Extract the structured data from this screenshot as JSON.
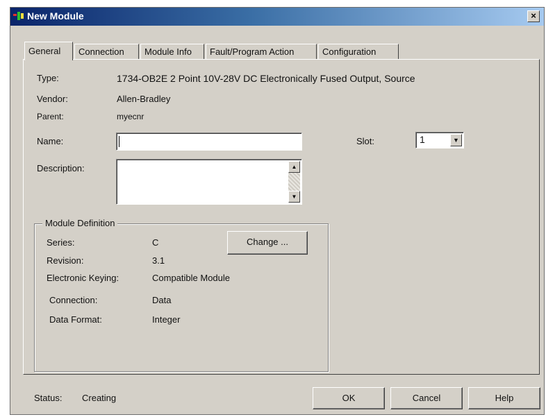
{
  "window": {
    "title": "New Module",
    "close_label": "×"
  },
  "tabs": [
    {
      "label": "General",
      "active": true
    },
    {
      "label": "Connection",
      "active": false
    },
    {
      "label": "Module Info",
      "active": false
    },
    {
      "label": "Fault/Program Action",
      "active": false
    },
    {
      "label": "Configuration",
      "active": false
    }
  ],
  "general": {
    "type_label": "Type:",
    "type_value": "1734-OB2E 2 Point 10V-28V DC Electronically Fused Output, Source",
    "vendor_label": "Vendor:",
    "vendor_value": "Allen-Bradley",
    "parent_label": "Parent:",
    "parent_value": "myecnr",
    "name_label": "Name:",
    "name_value": "",
    "description_label": "Description:",
    "description_value": "",
    "slot_label": "Slot:",
    "slot_value": "1"
  },
  "module_definition": {
    "title": "Module Definition",
    "series_label": "Series:",
    "series_value": "C",
    "revision_label": "Revision:",
    "revision_value": "3.1",
    "keying_label": "Electronic Keying:",
    "keying_value": "Compatible Module",
    "connection_label": "Connection:",
    "connection_value": "Data",
    "data_format_label": "Data Format:",
    "data_format_value": "Integer",
    "change_button": "Change ..."
  },
  "status": {
    "label": "Status:",
    "value": "Creating"
  },
  "buttons": {
    "ok": "OK",
    "cancel": "Cancel",
    "help": "Help"
  },
  "icons": {
    "app": "module-icon",
    "close": "close-icon",
    "scroll_up": "scroll-up-arrow-icon",
    "scroll_down": "scroll-down-arrow-icon",
    "dropdown": "chevron-down-icon"
  }
}
